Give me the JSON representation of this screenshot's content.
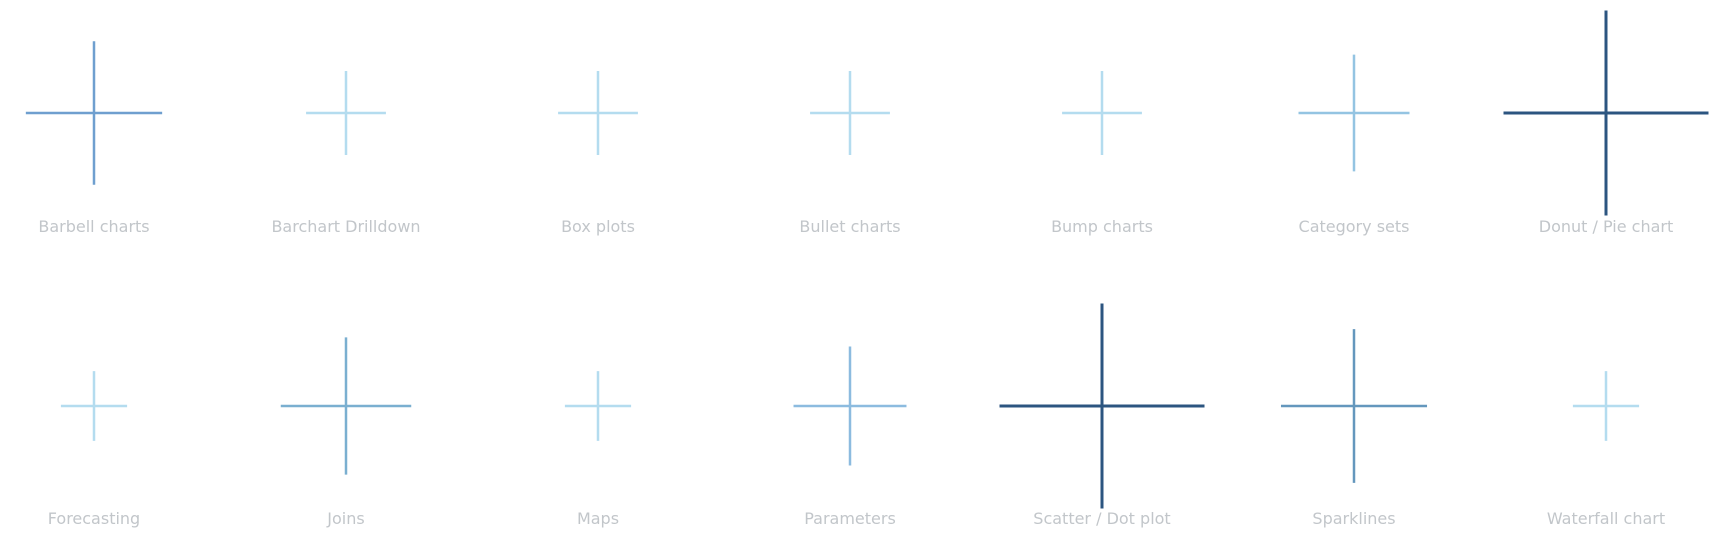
{
  "chart_data": {
    "type": "scatter",
    "marks": "cross",
    "rows": 2,
    "columns": 7,
    "items": [
      {
        "label": "Barbell charts",
        "size": 0.7,
        "color": "#6f9fcf"
      },
      {
        "label": "Barchart Drilldown",
        "size": 0.41,
        "color": "#b4dcef"
      },
      {
        "label": "Box plots",
        "size": 0.41,
        "color": "#b4dcef"
      },
      {
        "label": "Bullet charts",
        "size": 0.41,
        "color": "#b4dcef"
      },
      {
        "label": "Bump charts",
        "size": 0.41,
        "color": "#b4dcef"
      },
      {
        "label": "Category sets",
        "size": 0.57,
        "color": "#94c4e2"
      },
      {
        "label": "Donut / Pie chart",
        "size": 1.0,
        "color": "#2c5580"
      },
      {
        "label": "Forecasting",
        "size": 0.34,
        "color": "#b4dcef"
      },
      {
        "label": "Joins",
        "size": 0.67,
        "color": "#7aafd0"
      },
      {
        "label": "Maps",
        "size": 0.34,
        "color": "#b4dcef"
      },
      {
        "label": "Parameters",
        "size": 0.58,
        "color": "#8cbbdf"
      },
      {
        "label": "Scatter / Dot plot",
        "size": 1.0,
        "color": "#2c5580"
      },
      {
        "label": "Sparklines",
        "size": 0.75,
        "color": "#6497bd"
      },
      {
        "label": "Waterfall chart",
        "size": 0.34,
        "color": "#b4dcef"
      }
    ]
  }
}
